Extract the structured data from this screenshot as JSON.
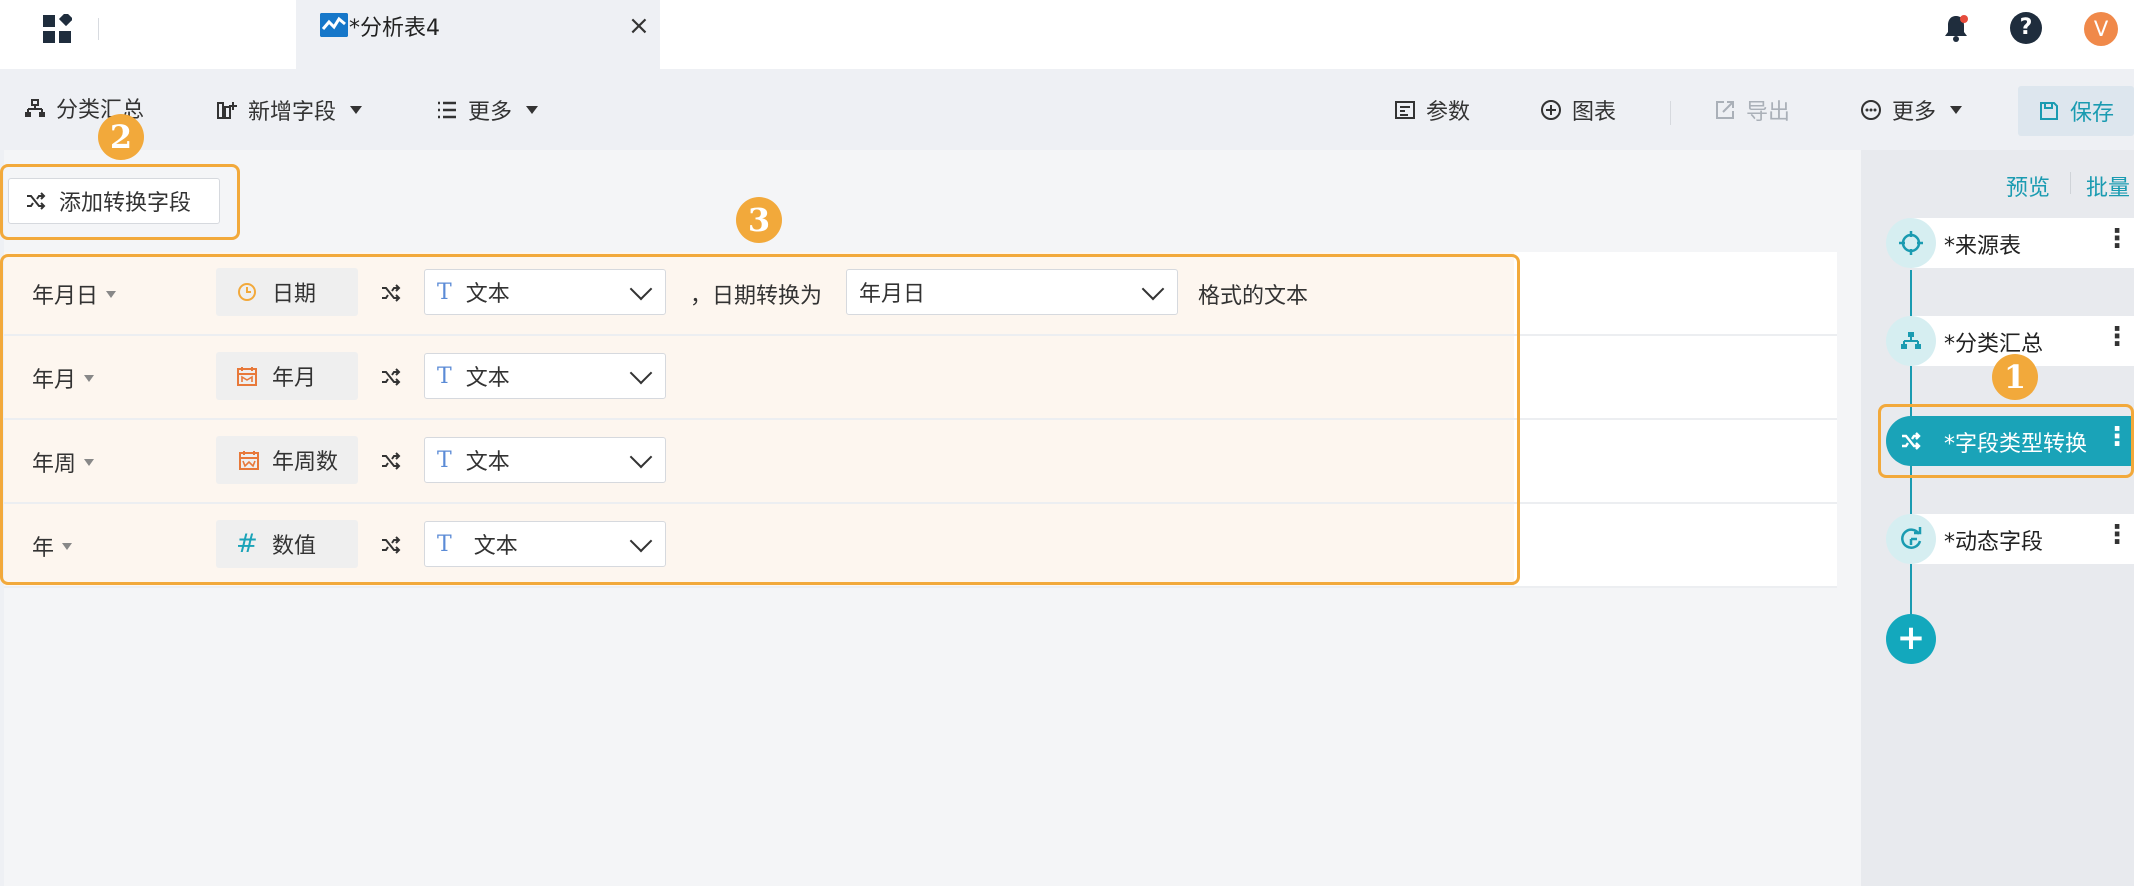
{
  "app": {
    "tab_title": "*分析表4",
    "tab_close": "×",
    "avatar_letter": "V",
    "help_glyph": "?"
  },
  "toolbar": {
    "left": [
      {
        "label": "分类汇总",
        "icon": "hierarchy-icon"
      },
      {
        "label": "新增字段",
        "icon": "add-column-icon"
      },
      {
        "label": "更多",
        "icon": "list-icon"
      }
    ],
    "right": [
      {
        "label": "参数",
        "icon": "parameter-icon"
      },
      {
        "label": "图表",
        "icon": "add-circle-icon"
      },
      {
        "label": "导出",
        "icon": "export-icon",
        "disabled": true
      },
      {
        "label": "更多",
        "icon": "more-circle-icon"
      }
    ],
    "save_label": "保存"
  },
  "main": {
    "add_button_label": "添加转换字段",
    "rows": [
      {
        "field": "年月日",
        "source_type": "日期",
        "source_icon": "clock-icon",
        "target": "文本",
        "suffix_prefix": "，日期转换为",
        "format_value": "年月日",
        "suffix": "格式的文本"
      },
      {
        "field": "年月",
        "source_type": "年月",
        "source_icon": "calendar-month-icon",
        "target": "文本"
      },
      {
        "field": "年周",
        "source_type": "年周数",
        "source_icon": "calendar-week-icon",
        "target": "文本"
      },
      {
        "field": "年",
        "source_type": "数值",
        "source_icon": "hash-icon",
        "target": "文本"
      }
    ]
  },
  "sidebar": {
    "preview_label": "预览",
    "batch_label": "批量",
    "nodes": [
      {
        "label": "*来源表",
        "icon": "target-icon"
      },
      {
        "label": "*分类汇总",
        "icon": "hierarchy-icon"
      },
      {
        "label": "*字段类型转换",
        "icon": "shuffle-icon",
        "active": true
      },
      {
        "label": "*动态字段",
        "icon": "dynamic-icon"
      }
    ],
    "add_node": "+"
  },
  "annotations": {
    "badge1": "1",
    "badge2": "2",
    "badge3": "3"
  },
  "colors": {
    "accent": "#1aa3b8",
    "highlight": "#f2a93b",
    "tab_icon": "#1677c9",
    "avatar": "#f0894a"
  }
}
